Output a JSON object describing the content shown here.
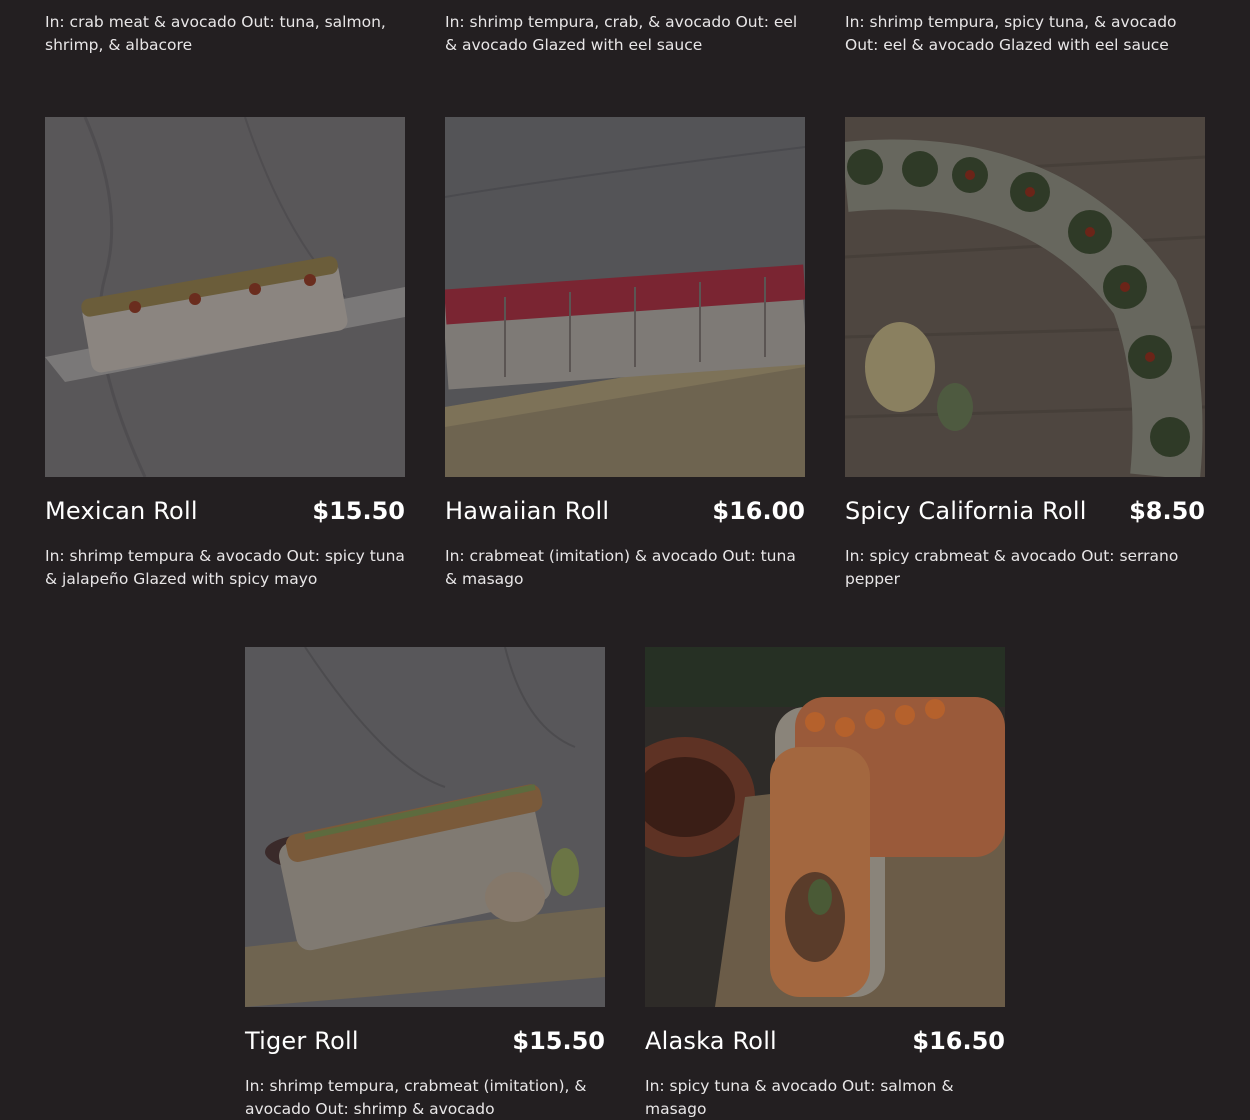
{
  "top_descriptions": [
    "In: crab meat & avocado Out: tuna, salmon, shrimp, & albacore",
    "In: shrimp tempura, crab, & avocado Out: eel & avocado Glazed with eel sauce",
    "In: shrimp tempura, spicy tuna, & avocado Out: eel & avocado Glazed with eel sauce"
  ],
  "menu_items": [
    {
      "name": "Mexican Roll",
      "price": "$15.50",
      "description": "In: shrimp tempura & avocado Out: spicy tuna & jalapeño Glazed with spicy mayo"
    },
    {
      "name": "Hawaiian Roll",
      "price": "$16.00",
      "description": "In: crabmeat (imitation) & avocado Out: tuna & masago"
    },
    {
      "name": "Spicy California Roll",
      "price": "$8.50",
      "description": "In: spicy crabmeat & avocado Out: serrano pepper"
    },
    {
      "name": "Tiger Roll",
      "price": "$15.50",
      "description": "In: shrimp tempura, crabmeat (imitation), & avocado Out: shrimp & avocado"
    },
    {
      "name": "Alaska Roll",
      "price": "$16.50",
      "description": "In: spicy tuna & avocado Out: salmon & masago"
    }
  ],
  "colors": {
    "background": "#231f21",
    "text": "#ffffff"
  }
}
